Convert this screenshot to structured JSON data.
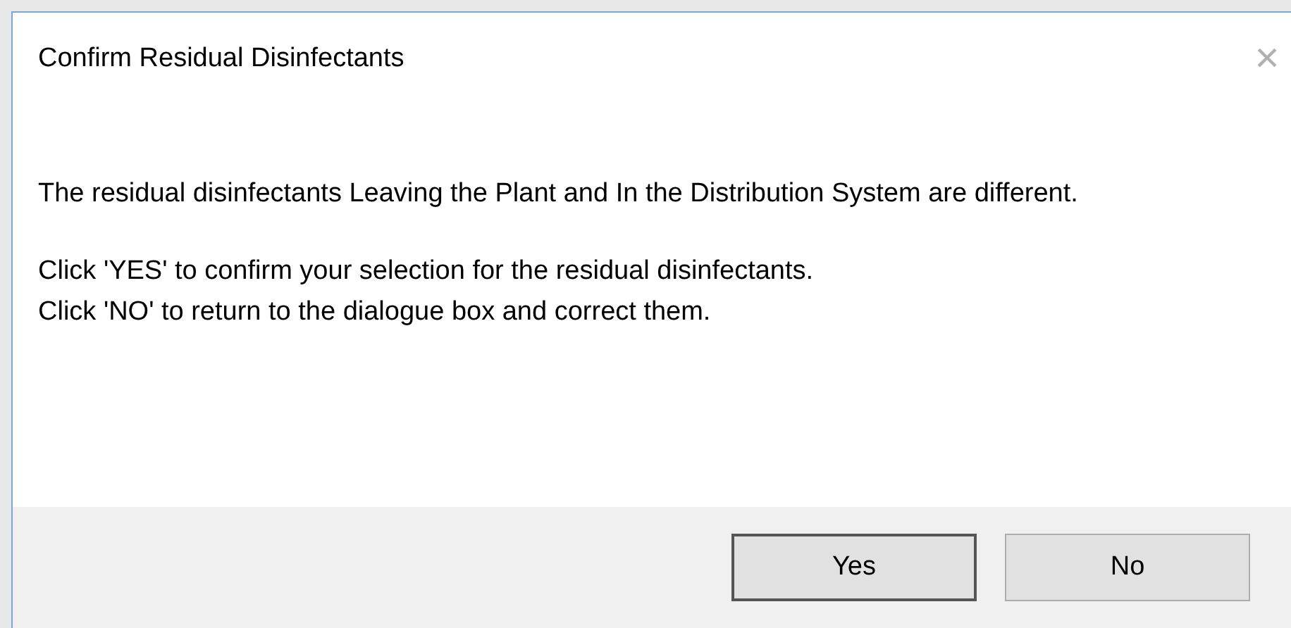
{
  "window": {
    "title": "Confirm Residual Disinfectants",
    "close": "×"
  },
  "message": [
    "The residual disinfectants Leaving the Plant and In the Distribution System are different.",
    "Click 'YES' to confirm your selection for the residual disinfectants.\nClick 'NO' to return to the dialogue box and correct them."
  ],
  "buttons": [
    {
      "label": "Yes",
      "default": true
    },
    {
      "label": "No",
      "default": false
    }
  ]
}
